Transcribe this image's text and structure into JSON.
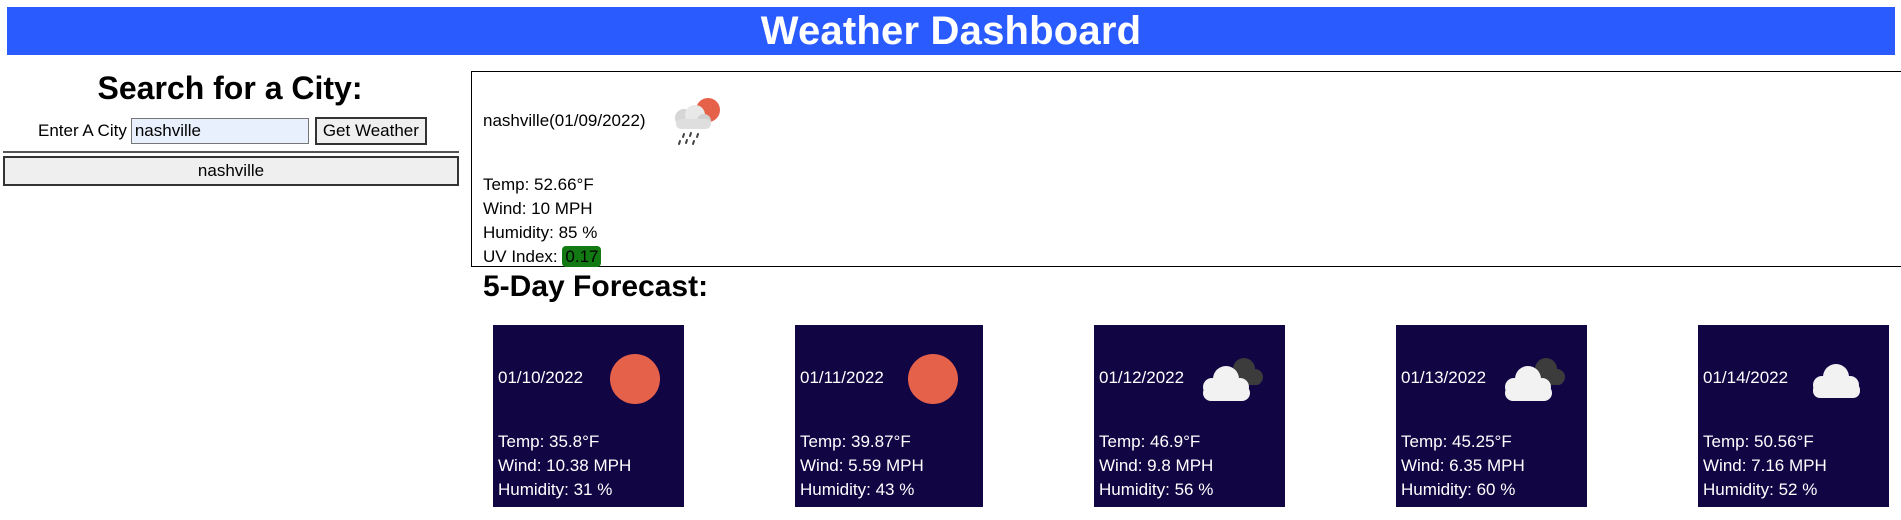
{
  "header": {
    "title": "Weather Dashboard"
  },
  "search": {
    "title": "Search for a City:",
    "label": "Enter A City",
    "value": "nashville",
    "button_label": "Get Weather",
    "history": [
      "nashville"
    ]
  },
  "current": {
    "city_date": "nashville(01/09/2022)",
    "icon": "rain-cloud-sun-icon",
    "temp": "Temp: 52.66°F",
    "wind": "Wind: 10 MPH",
    "humidity": "Humidity: 85 %",
    "uv_label": "UV Index:",
    "uv_value": "0.17",
    "uv_color": "#137a13"
  },
  "forecast": {
    "title": "5-Day Forecast:",
    "days": [
      {
        "date": "01/10/2022",
        "icon": "sun-icon",
        "temp": "Temp: 35.8°F",
        "wind": "Wind: 10.38 MPH",
        "humidity": "Humidity: 31 %"
      },
      {
        "date": "01/11/2022",
        "icon": "sun-icon",
        "temp": "Temp: 39.87°F",
        "wind": "Wind: 5.59 MPH",
        "humidity": "Humidity: 43 %"
      },
      {
        "date": "01/12/2022",
        "icon": "broken-clouds-icon",
        "temp": "Temp: 46.9°F",
        "wind": "Wind: 9.8 MPH",
        "humidity": "Humidity: 56 %"
      },
      {
        "date": "01/13/2022",
        "icon": "broken-clouds-icon",
        "temp": "Temp: 45.25°F",
        "wind": "Wind: 6.35 MPH",
        "humidity": "Humidity: 60 %"
      },
      {
        "date": "01/14/2022",
        "icon": "cloud-icon",
        "temp": "Temp: 50.56°F",
        "wind": "Wind: 7.16 MPH",
        "humidity": "Humidity: 52 %"
      }
    ]
  },
  "colors": {
    "header_bg": "#2a5bff",
    "card_bg": "#110544",
    "sun": "#e5614a"
  }
}
